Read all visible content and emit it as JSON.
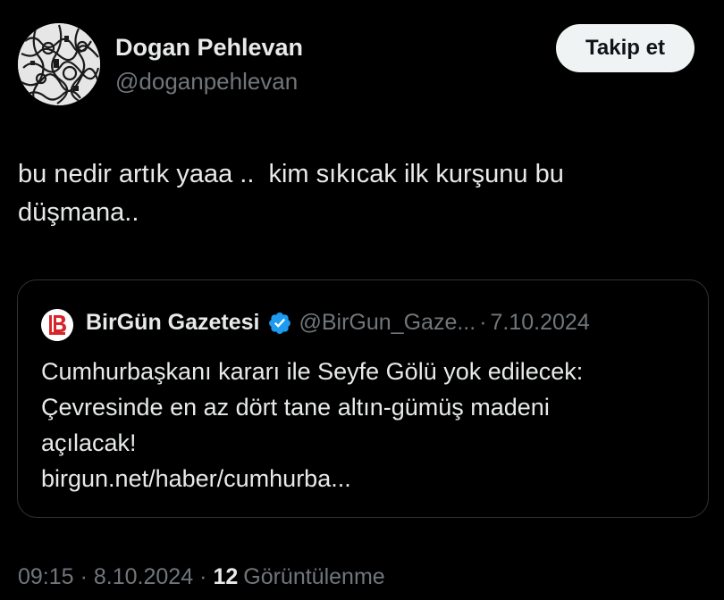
{
  "author": {
    "display_name": "Dogan Pehlevan",
    "handle": "@doganpehlevan",
    "avatar_icon": "avatar-pattern-icon"
  },
  "follow_button": {
    "label": "Takip et"
  },
  "tweet": {
    "text": "bu nedir artık yaaa ..  kim sıkıcak ilk kurşunu bu\ndüşmana.."
  },
  "quote": {
    "logo_icon": "birgun-logo-icon",
    "name": "BirGün Gazetesi",
    "verified_icon": "verified-badge-icon",
    "handle": "@BirGun_Gaze...",
    "separator": "·",
    "date": "7.10.2024",
    "lines": [
      "Cumhurbaşkanı kararı ile Seyfe Gölü yok edilecek:",
      "Çevresinde en az dört tane altın-gümüş madeni",
      "açılacak!",
      "birgun.net/haber/cumhurba..."
    ]
  },
  "meta": {
    "time": "09:15",
    "separator": "·",
    "date": "8.10.2024",
    "views_count": "12",
    "views_label": "Görüntülenme"
  },
  "colors": {
    "background": "#000000",
    "text_primary": "#e7e9ea",
    "text_secondary": "#71767b",
    "border": "#2f3336",
    "verified_blue": "#1d9bf0",
    "birgun_red": "#d7262b"
  }
}
